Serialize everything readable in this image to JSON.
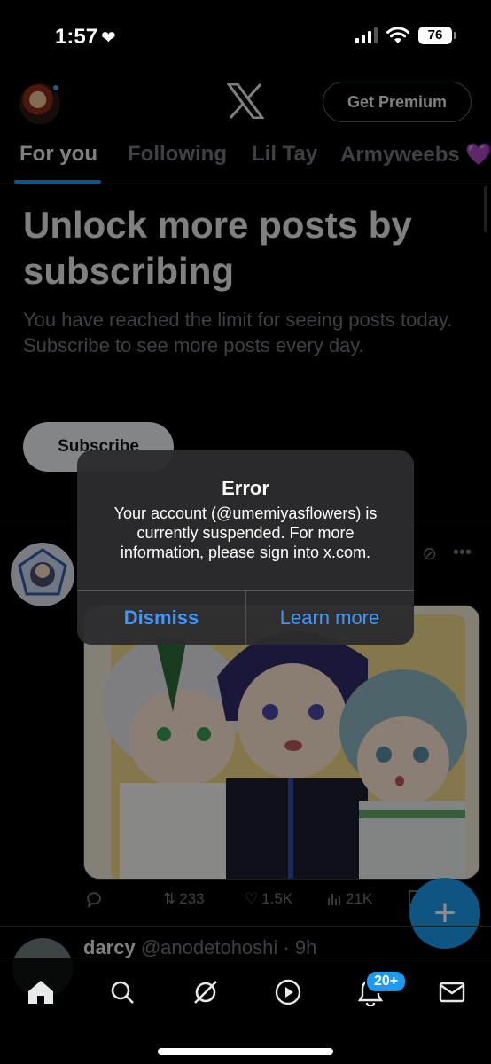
{
  "status_bar": {
    "time": "1:57",
    "battery": "76"
  },
  "header": {
    "premium_label": "Get Premium"
  },
  "tabs": [
    {
      "label": "For you",
      "active": true
    },
    {
      "label": "Following",
      "active": false
    },
    {
      "label": "Lil Tay",
      "active": false
    },
    {
      "label": "Armyweebs 💜",
      "active": false
    }
  ],
  "unlock": {
    "title": "Unlock more posts by subscribing",
    "subtitle": "You have reached the limit for seeing posts today. Subscribe to see more posts every day.",
    "subscribe_label": "Subscribe"
  },
  "post": {
    "replies": "",
    "reposts": "233",
    "likes": "1.5K",
    "views": "21K"
  },
  "post2": {
    "name": "darcy",
    "handle": "@anodetohoshi · 9h"
  },
  "alert": {
    "title": "Error",
    "message": "Your account (@umemiyasflowers) is currently suspended. For more information, please sign into x.com.",
    "dismiss_label": "Dismiss",
    "learn_more_label": "Learn more"
  },
  "bottom_nav": {
    "notifications_badge": "20+",
    "items": [
      "home-icon",
      "search-icon",
      "grok-icon",
      "video-icon",
      "notifications-icon",
      "messages-icon"
    ]
  },
  "colors": {
    "accent": "#1d9bf0",
    "alert_button": "#3e97ff",
    "background": "#000000"
  }
}
